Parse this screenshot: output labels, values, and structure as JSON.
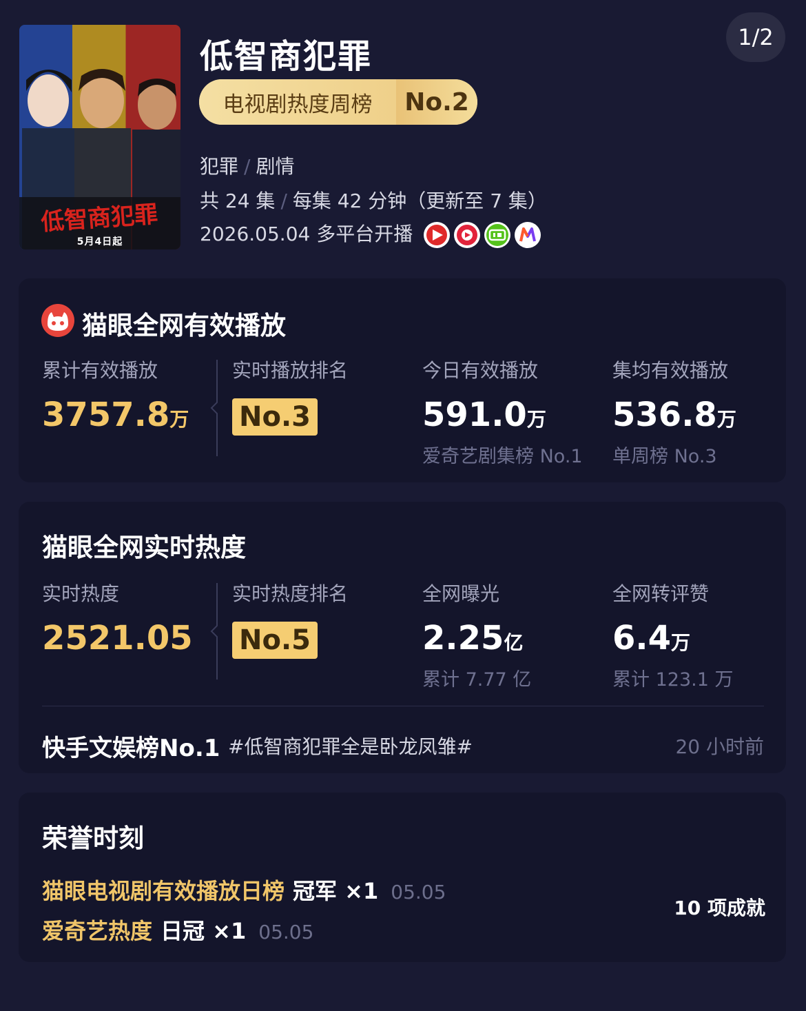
{
  "page_indicator": "1/2",
  "poster": {
    "date": "5月4日起"
  },
  "show": {
    "title": "低智商犯罪",
    "rank_name": "电视剧热度周榜",
    "rank_no": "No.2",
    "genre_1": "犯罪",
    "genre_2": "剧情",
    "episodes": "共 24 集",
    "episode_length": "每集 42 分钟（更新至 7 集）",
    "premiere": "2026.05.04 多平台开播",
    "platforms": [
      "tencent-video-icon",
      "youku-icon",
      "iqiyi-icon",
      "mgtv-icon"
    ]
  },
  "playback": {
    "title": "猫眼全网有效播放",
    "cumulative_label": "累计有效播放",
    "cumulative_value": "3757.8",
    "cumulative_unit": "万",
    "realtime_rank_label": "实时播放排名",
    "realtime_rank_value": "No.3",
    "today_label": "今日有效播放",
    "today_value": "591.0",
    "today_unit": "万",
    "today_sub": "爱奇艺剧集榜 No.1",
    "avg_label": "集均有效播放",
    "avg_value": "536.8",
    "avg_unit": "万",
    "avg_sub": "单周榜 No.3"
  },
  "heat": {
    "title": "猫眼全网实时热度",
    "realtime_label": "实时热度",
    "realtime_value": "2521.05",
    "rank_label": "实时热度排名",
    "rank_value": "No.5",
    "exposure_label": "全网曝光",
    "exposure_value": "2.25",
    "exposure_unit": "亿",
    "exposure_sub": "累计 7.77 亿",
    "engage_label": "全网转评赞",
    "engage_value": "6.4",
    "engage_unit": "万",
    "engage_sub": "累计 123.1 万",
    "kuaishou_title": "快手文娱榜No.1",
    "kuaishou_tag": "#低智商犯罪全是卧龙凤雏#",
    "kuaishou_time": "20 小时前"
  },
  "honors": {
    "title": "荣誉时刻",
    "items": [
      {
        "name": "猫眼电视剧有效播放日榜",
        "award": "冠军 ×1",
        "date": "05.05"
      },
      {
        "name": "爱奇艺热度",
        "award": "日冠 ×1",
        "date": "05.05"
      }
    ],
    "count": "10 项成就"
  },
  "colors": {
    "background": "#191a33",
    "card": "#14152b",
    "gold": "#f3c769",
    "badge": "#f5cd72",
    "muted": "#a2a4bb"
  }
}
